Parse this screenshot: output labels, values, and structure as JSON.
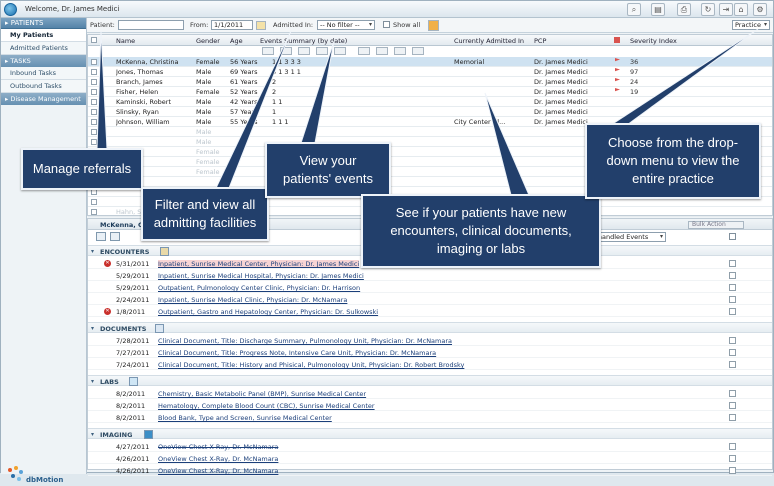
{
  "app": {
    "welcome": "Welcome, Dr. James Medici",
    "brand": "dbMotion"
  },
  "toolbar_icons": [
    "search-icon",
    "document-icon",
    "print-icon",
    "refresh-icon",
    "exit-icon",
    "home-icon",
    "settings-icon"
  ],
  "sidebar": {
    "patients_header": "PATIENTS",
    "items": [
      {
        "label": "My Patients",
        "active": true
      },
      {
        "label": "Admitted Patients",
        "active": false
      }
    ],
    "tasks_header": "TASKS",
    "task_items": [
      {
        "label": "Inbound Tasks"
      },
      {
        "label": "Outbound Tasks"
      }
    ],
    "disease_header": "Disease Management"
  },
  "filters": {
    "patient_label": "Patient:",
    "patient_value": "",
    "from_label": "From:",
    "from_value": "1/1/2011",
    "admitted_label": "Admitted In:",
    "admitted_value": "-- No filter --",
    "show_all_label": "Show all",
    "scope_value": "Practice"
  },
  "grid": {
    "headers": {
      "name": "Name",
      "gender": "Gender",
      "age": "Age",
      "events": "Events Summary  (by date)",
      "admitted": "Currently Admitted In",
      "pcp": "PCP",
      "severity": "Severity Index"
    },
    "rows": [
      {
        "name": "McKenna, Christina",
        "gender": "Female",
        "age": "56 Years",
        "events": "1    1    3    3    3",
        "admitted": "Memorial",
        "pcp": "Dr. James Medici",
        "flag": true,
        "severity": "36",
        "selected": true
      },
      {
        "name": "Jones, Thomas",
        "gender": "Male",
        "age": "69 Years",
        "events": "3    1    3    1    1",
        "admitted": "",
        "pcp": "Dr. James Medici",
        "flag": true,
        "severity": "97",
        "selected": false
      },
      {
        "name": "Branch, James",
        "gender": "Male",
        "age": "61 Years",
        "events": "2",
        "admitted": "",
        "pcp": "Dr. James Medici",
        "flag": true,
        "severity": "24",
        "selected": false
      },
      {
        "name": "Fisher, Helen",
        "gender": "Female",
        "age": "52 Years",
        "events": "2",
        "admitted": "",
        "pcp": "Dr. James Medici",
        "flag": true,
        "severity": "19",
        "selected": false
      },
      {
        "name": "Kaminski, Robert",
        "gender": "Male",
        "age": "42 Years",
        "events": "1    1",
        "admitted": "",
        "pcp": "Dr. James Medici",
        "flag": false,
        "severity": "",
        "selected": false
      },
      {
        "name": "Slinsky, Ryan",
        "gender": "Male",
        "age": "57 Years",
        "events": "1",
        "admitted": "",
        "pcp": "Dr. James Medici",
        "flag": false,
        "severity": "",
        "selected": false
      },
      {
        "name": "Johnson, William",
        "gender": "Male",
        "age": "55 Years",
        "events": "1    1    1",
        "admitted": "City Center Cl...",
        "pcp": "Dr. James Medici",
        "flag": false,
        "severity": "",
        "selected": false
      },
      {
        "name": "",
        "gender": "Male",
        "age": "",
        "events": "",
        "admitted": "",
        "pcp": "",
        "flag": false,
        "severity": "",
        "selected": false,
        "faded": true
      },
      {
        "name": "",
        "gender": "Male",
        "age": "",
        "events": "",
        "admitted": "",
        "pcp": "",
        "flag": false,
        "severity": "",
        "selected": false,
        "faded": true
      },
      {
        "name": "",
        "gender": "Female",
        "age": "",
        "events": "",
        "admitted": "",
        "pcp": "",
        "flag": false,
        "severity": "",
        "selected": false,
        "faded": true
      },
      {
        "name": "",
        "gender": "Female",
        "age": "",
        "events": "",
        "admitted": "",
        "pcp": "",
        "flag": false,
        "severity": "",
        "selected": false,
        "faded": true
      },
      {
        "name": "",
        "gender": "Female",
        "age": "",
        "events": "",
        "admitted": "",
        "pcp": "",
        "flag": false,
        "severity": "",
        "selected": false,
        "faded": true
      },
      {
        "name": "",
        "gender": "",
        "age": "",
        "events": "",
        "admitted": "",
        "pcp": "",
        "flag": false,
        "severity": "",
        "selected": false,
        "faded": true
      },
      {
        "name": "",
        "gender": "",
        "age": "",
        "events": "",
        "admitted": "",
        "pcp": "",
        "flag": false,
        "severity": "",
        "selected": false,
        "faded": true
      },
      {
        "name": "",
        "gender": "",
        "age": "",
        "events": "",
        "admitted": "",
        "pcp": "",
        "flag": false,
        "severity": "",
        "selected": false,
        "faded": true
      },
      {
        "name": "Hahn, Scott",
        "gender": "Male",
        "age": "31 Years",
        "events": "",
        "admitted": "",
        "pcp": "",
        "flag": false,
        "severity": "",
        "selected": false,
        "faded": true
      }
    ]
  },
  "detail": {
    "patient": "McKenna, C",
    "events_filter": "Unhandled Events",
    "bulk_action": "Bulk Action",
    "sections": [
      {
        "title": "ENCOUNTERS",
        "rows": [
          {
            "date": "5/31/2011",
            "desc": "Inpatient, Sunrise Medical Center, Physician: Dr. James Medici",
            "alert": true,
            "highlight": true
          },
          {
            "date": "5/29/2011",
            "desc": "Inpatient, Sunrise Medical Hospital, Physician: Dr. James Medici",
            "alert": false
          },
          {
            "date": "5/29/2011",
            "desc": "Outpatient, Pulmonology Center Clinic, Physician: Dr. Harrison",
            "alert": false
          },
          {
            "date": "2/24/2011",
            "desc": "Inpatient, Sunrise Medical Clinic, Physician: Dr. McNamara",
            "alert": false
          },
          {
            "date": "1/8/2011",
            "desc": "Outpatient, Gastro and Hepatology Center, Physician: Dr. Sulkowski",
            "alert": true
          }
        ]
      },
      {
        "title": "DOCUMENTS",
        "rows": [
          {
            "date": "7/28/2011",
            "desc": "Clinical Document, Title: Discharge Summary, Pulmonology Unit, Physician: Dr. McNamara"
          },
          {
            "date": "7/27/2011",
            "desc": "Clinical Document, Title: Progress Note, Intensive Care Unit, Physician: Dr. McNamara"
          },
          {
            "date": "7/24/2011",
            "desc": "Clinical Document, Title: History and Phisical, Pulmonology Unit, Physician: Dr. Robert Brodsky"
          }
        ]
      },
      {
        "title": "LABS",
        "rows": [
          {
            "date": "8/2/2011",
            "desc": "Chemistry, Basic Metabolic Panel (BMP), Sunrise Medical Center"
          },
          {
            "date": "8/2/2011",
            "desc": "Hematology, Complete Blood Count (CBC), Sunrise Medical Center"
          },
          {
            "date": "8/2/2011",
            "desc": "Blood Bank, Type and Screen, Sunrise Medical Center"
          }
        ]
      },
      {
        "title": "IMAGING",
        "rows": [
          {
            "date": "4/27/2011",
            "desc": "OneView Chest X-Ray, Dr. McNamara",
            "strike": true
          },
          {
            "date": "4/26/2011",
            "desc": "OneView Chest X-Ray, Dr. McNamara"
          },
          {
            "date": "4/26/2011",
            "desc": "OneView Chest X-Ray, Dr. McNamara"
          }
        ]
      }
    ]
  },
  "callouts": {
    "referrals": "Manage referrals",
    "admitting": "Filter and view all admitting facilities",
    "events": "View your patients' events",
    "new_items": "See if your patients have new encounters, clinical documents, imaging or labs",
    "practice": "Choose from the drop-down menu to view the entire practice"
  },
  "colors": {
    "callout_bg": "#223f6b",
    "sidebar_header": "#5483a8",
    "selected_row": "#cfe2f1",
    "flag_red": "#d9534f"
  }
}
